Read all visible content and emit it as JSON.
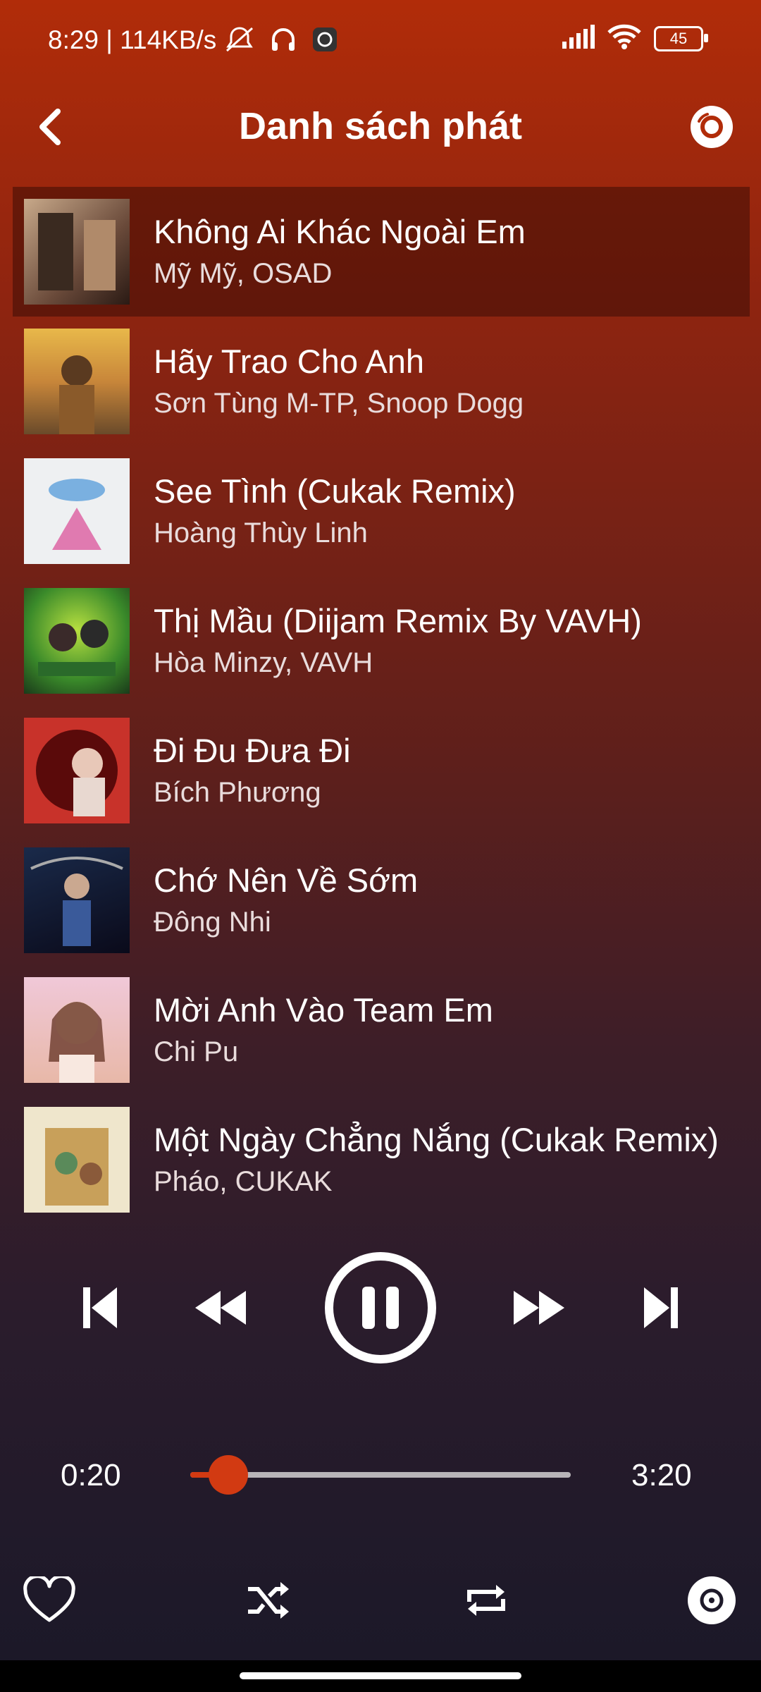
{
  "status": {
    "time": "8:29 | 114KB/s",
    "battery": "45",
    "icons": [
      "mute-icon",
      "headphones-icon",
      "camera-icon",
      "signal-icon",
      "wifi-icon",
      "battery-icon"
    ]
  },
  "header": {
    "title": "Danh sách phát",
    "back_icon": "chevron-left-icon",
    "right_icon": "disc-icon"
  },
  "playlist": [
    {
      "title": "Không Ai Khác Ngoài Em",
      "artist": "Mỹ Mỹ, OSAD",
      "active": true
    },
    {
      "title": "Hãy Trao Cho Anh",
      "artist": "Sơn Tùng M-TP, Snoop Dogg"
    },
    {
      "title": "See Tình (Cukak Remix)",
      "artist": "Hoàng Thùy Linh"
    },
    {
      "title": "Thị Mầu (Diijam Remix By VAVH)",
      "artist": "Hòa Minzy, VAVH"
    },
    {
      "title": "Đi Đu Đưa Đi",
      "artist": "Bích Phương"
    },
    {
      "title": "Chớ Nên Về Sớm",
      "artist": "Đông Nhi"
    },
    {
      "title": "Mời Anh Vào Team Em",
      "artist": "Chi Pu"
    },
    {
      "title": "Một Ngày Chẳng Nắng (Cukak Remix)",
      "artist": "Pháo, CUKAK"
    }
  ],
  "player": {
    "current_time": "0:20",
    "total_time": "3:20",
    "progress_fraction": 0.1,
    "accent_color": "#d23a12"
  },
  "bottom_bar": {
    "icons": [
      "heart-icon",
      "shuffle-icon",
      "repeat-icon",
      "disc-icon"
    ]
  }
}
